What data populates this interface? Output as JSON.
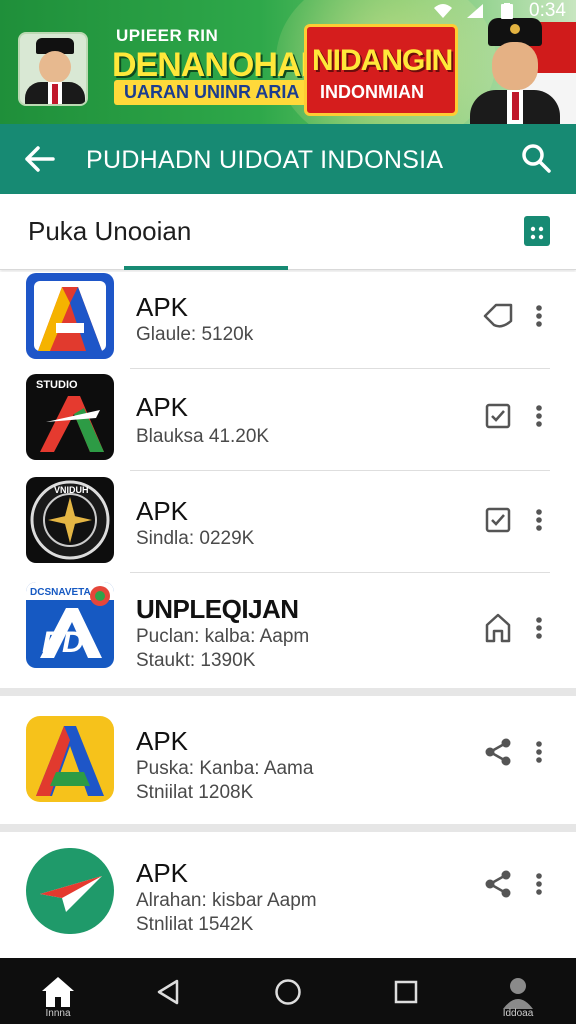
{
  "status_bar": {
    "time": "0:34",
    "icons": [
      "wifi-icon",
      "signal-icon",
      "battery-icon"
    ]
  },
  "banner": {
    "small_text": "UPIEER RIN",
    "title": "DENANOHAN",
    "subtitle": "UARAN UNINR ARIA",
    "red_title": "NIDANGIN",
    "red_subtitle": "INDONMIAN"
  },
  "app_bar": {
    "title": "PUDHADN UIDOAT INDONSIA",
    "back_icon": "arrow-left-icon",
    "search_icon": "search-icon"
  },
  "sub_header": {
    "title": "Puka Unooian",
    "action_icon": "bookmark-icon"
  },
  "items": [
    {
      "name": "APK",
      "meta1": "Glaule: 5120k",
      "action_icon": "tag-icon",
      "icon": "app-icon-a-blue"
    },
    {
      "name": "APK",
      "meta1": "Blauksa 41.20K",
      "action_icon": "checkbox-icon",
      "icon": "app-icon-a-studio",
      "icon_text": "STUDIO"
    },
    {
      "name": "APK",
      "meta1": "Sindla: 0229K",
      "action_icon": "checkbox-icon",
      "icon": "app-icon-compass-badge",
      "icon_text": "VNIDUH"
    },
    {
      "name": "UNPLEQIJAN",
      "meta1": "Puclan: kalba: Aapm",
      "meta2": "Staukt: 1390K",
      "action_icon": "home-outline-icon",
      "icon": "app-icon-pd",
      "icon_text": "DCSNAVETA"
    },
    {
      "name": "APK",
      "meta1": "Puska: Kanba: Aama",
      "meta2": "Stniilat 1208K",
      "action_icon": "share-icon",
      "icon": "app-icon-a-yellow"
    },
    {
      "name": "APK",
      "meta1": "Alrahan: kisbar Aapm",
      "meta2": "Stnlilat 1542K",
      "action_icon": "share-icon",
      "icon": "app-icon-plane-green"
    }
  ],
  "nav": {
    "home_label": "Innna",
    "profile_label": "Iddoaa"
  },
  "colors": {
    "primary": "#178a73",
    "banner_green": "#2ea84a",
    "banner_yellow": "#ffe83a",
    "banner_red": "#d51d1d"
  }
}
